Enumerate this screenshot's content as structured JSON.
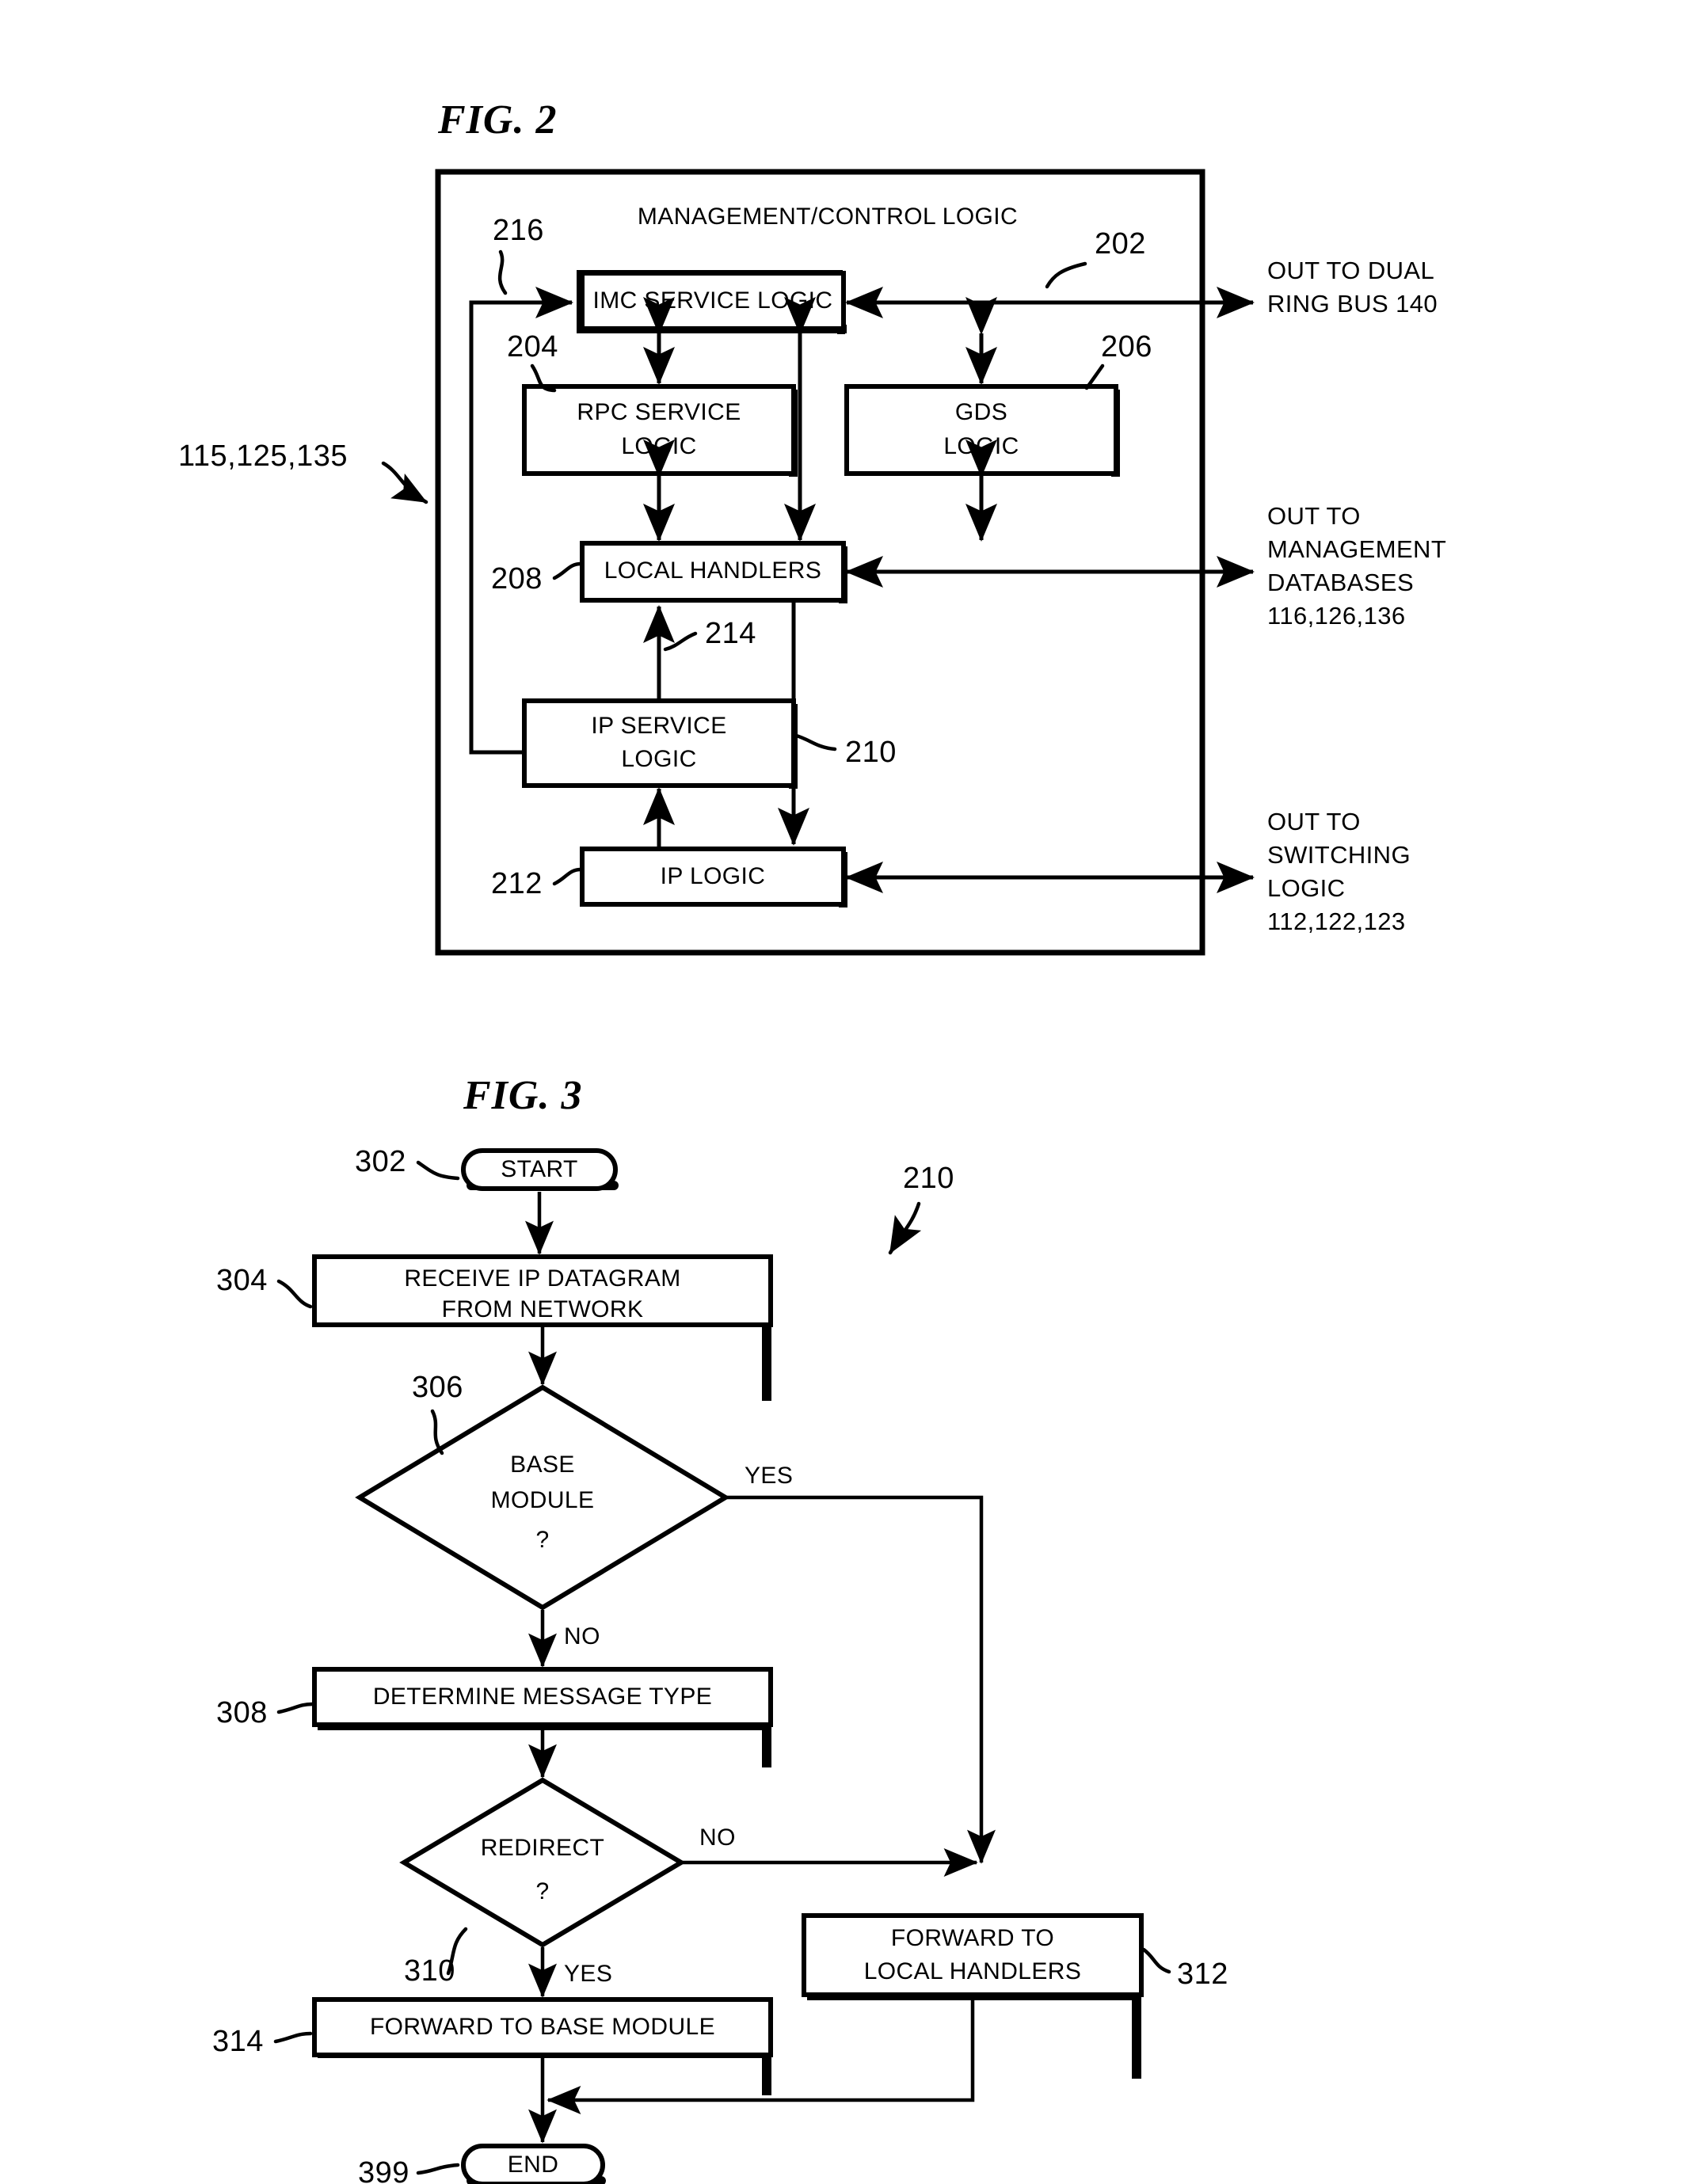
{
  "figures": [
    {
      "id": "fig2",
      "title": "FIG. 2",
      "container_label": "MANAGEMENT/CONTROL LOGIC",
      "container_ref": "115,125,135",
      "boxes": [
        {
          "key": "imc",
          "label": "IMC SERVICE LOGIC",
          "ref": "202"
        },
        {
          "key": "rpc",
          "label_line1": "RPC SERVICE",
          "label_line2": "LOGIC",
          "ref": "204"
        },
        {
          "key": "gds",
          "label_line1": "GDS",
          "label_line2": "LOGIC",
          "ref": "206"
        },
        {
          "key": "local",
          "label": "LOCAL HANDLERS",
          "ref": "208"
        },
        {
          "key": "ipsvc",
          "label_line1": "IP SERVICE",
          "label_line2": "LOGIC",
          "ref": "210"
        },
        {
          "key": "iplog",
          "label": "IP LOGIC",
          "ref": "212"
        }
      ],
      "connector_refs": [
        {
          "key": "feedback",
          "ref": "216"
        },
        {
          "key": "ipsvc_to_local",
          "ref": "214"
        }
      ],
      "external_ports": [
        {
          "key": "ring_bus",
          "line1": "OUT TO DUAL",
          "line2": "RING BUS 140",
          "line3": "",
          "line4": ""
        },
        {
          "key": "mgmt_db",
          "line1": "OUT TO",
          "line2": "MANAGEMENT",
          "line3": "DATABASES",
          "line4": "116,126,136"
        },
        {
          "key": "switching",
          "line1": "OUT TO",
          "line2": "SWITCHING",
          "line3": "LOGIC",
          "line4": "112,122,123"
        }
      ]
    },
    {
      "id": "fig3",
      "title": "FIG. 3",
      "flow_ref": "210",
      "nodes": [
        {
          "key": "start",
          "type": "terminator",
          "label": "START",
          "ref": "302"
        },
        {
          "key": "receive",
          "type": "process",
          "label_line1": "RECEIVE IP DATAGRAM",
          "label_line2": "FROM NETWORK",
          "ref": "304"
        },
        {
          "key": "base_module",
          "type": "decision",
          "label_line1": "BASE",
          "label_line2": "MODULE",
          "label_line3": "?",
          "ref": "306"
        },
        {
          "key": "determine",
          "type": "process",
          "label": "DETERMINE MESSAGE TYPE",
          "ref": "308"
        },
        {
          "key": "redirect",
          "type": "decision",
          "label_line1": "REDIRECT",
          "label_line2": "?",
          "ref": "310"
        },
        {
          "key": "fwd_local",
          "type": "process",
          "label_line1": "FORWARD TO",
          "label_line2": "LOCAL HANDLERS",
          "ref": "312"
        },
        {
          "key": "fwd_base",
          "type": "process",
          "label": "FORWARD TO BASE MODULE",
          "ref": "314"
        },
        {
          "key": "end",
          "type": "terminator",
          "label": "END",
          "ref": "399"
        }
      ],
      "edge_labels": [
        {
          "key": "base_yes",
          "text": "YES"
        },
        {
          "key": "base_no",
          "text": "NO"
        },
        {
          "key": "redirect_no",
          "text": "NO"
        },
        {
          "key": "redirect_yes",
          "text": "YES"
        }
      ]
    }
  ],
  "colors": {
    "ink": "#000000",
    "paper": "#ffffff"
  }
}
